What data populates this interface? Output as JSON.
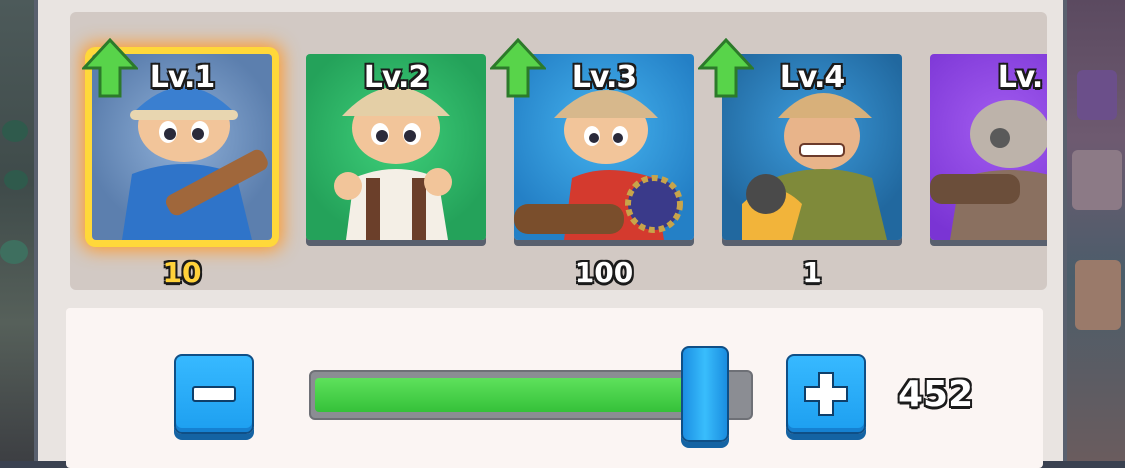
{
  "cards": [
    {
      "level": "Lv.1",
      "count": "10",
      "upgradable": true,
      "selected": true,
      "bg": "#6c8fb9"
    },
    {
      "level": "Lv.2",
      "count": "",
      "upgradable": false,
      "selected": false,
      "bg": "#2bb064"
    },
    {
      "level": "Lv.3",
      "count": "100",
      "upgradable": true,
      "selected": false,
      "bg": "#2b8fcf"
    },
    {
      "level": "Lv.4",
      "count": "1",
      "upgradable": true,
      "selected": false,
      "bg": "#2f7fbf"
    },
    {
      "level": "Lv.",
      "count": "",
      "upgradable": false,
      "selected": false,
      "bg": "#8a3fe0"
    }
  ],
  "quantity": {
    "minus_label": "−",
    "plus_label": "+",
    "value": "452",
    "slider_fraction": 0.93
  },
  "colors": {
    "upgrade_arrow": "#58d44a",
    "selection_glow": "#ffd83a",
    "button_blue": "#1d9ff0",
    "slider_green": "#35c13a"
  },
  "icons": {
    "upgrade": "up-arrow-icon",
    "minus": "minus-icon",
    "plus": "plus-icon"
  }
}
